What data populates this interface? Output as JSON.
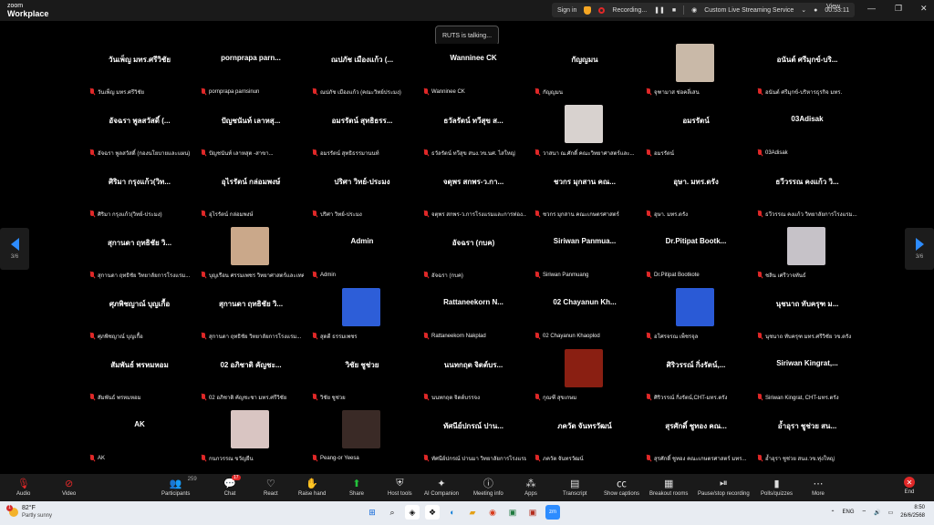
{
  "app": {
    "brand_line1": "zoom",
    "brand_line2": "Workplace"
  },
  "titlebar": {
    "sign_in": "Sign in",
    "recording": "Recording...",
    "streaming": "Custom Live Streaming Service",
    "timer": "00:53:11",
    "view": "View"
  },
  "talking": "RUTS is talking...",
  "pager": {
    "left": "3/6",
    "right": "3/6"
  },
  "tiles": [
    {
      "display": "วันเพ็ญ มทร.ศรีวิชัย",
      "label": "วันเพ็ญ มทร.ศรีวิชัย"
    },
    {
      "display": "pornprapa  parn...",
      "label": "pornprapa parnsinun"
    },
    {
      "display": "ณปภัช เมืองแก้ว (...",
      "label": "ณปภัช เมืองแก้ว (คณะวิทย์ประมง)"
    },
    {
      "display": "Wanninee CK",
      "label": "Wanninee CK"
    },
    {
      "display": "กัญญมน",
      "label": "กัญญมน"
    },
    {
      "display": "",
      "label": "จุฑามาส ช่อคลี่เสน",
      "photo": "#c9b9a8"
    },
    {
      "display": "อนันต์ ศรีมุกข์-บริ...",
      "label": "อนันต์ ศรีมุกข์-บริหารธุรกิจ มทร."
    },
    {
      "display": "อัจฉรา พูลสวัสดิ์ (...",
      "label": "อัจฉรา พูลสวัสดิ์ (กองนโยบายและแผน)"
    },
    {
      "display": "ปัญชนันท์ เลาหสุ...",
      "label": "ปัญชนันท์ เลาหสุต -สาขา..."
    },
    {
      "display": "อมรรัตน์ สุทธิธรร...",
      "label": "อมรรัตน์ สุทธิธรรมานนท์"
    },
    {
      "display": "ธวัลรัตน์ ทวีสุข ส...",
      "label": "ธวัลรัตน์ ทวีสุข สนง.วข.นศ. ไสใหญ่"
    },
    {
      "display": "",
      "label": "วาสนา ณ.ศักดิ์ คณะวิทยาศาสตร์และ...",
      "photo": "#d8d2cf"
    },
    {
      "display": "อมรรัตน์",
      "label": "อมรรัตน์"
    },
    {
      "display": "03Adisak",
      "label": "03Adisak"
    },
    {
      "display": "ศิริมา กรุงแก้ว(วิท...",
      "label": "ศิริมา กรุงแก้ว(วิทย์-ประมง)"
    },
    {
      "display": "อุไรรัตน์ กล่อมพงษ์",
      "label": "อุไรรัตน์ กล่อมพงษ์"
    },
    {
      "display": "ปริศา วิทย์-ประมง",
      "label": "ปริศา วิทย์-ประมง"
    },
    {
      "display": "จตุพร สกพร-ว.กา...",
      "label": "จตุพร สกพร-ว.การโรงแรมและการท่อง..."
    },
    {
      "display": "ชวกร มุกสาน คณ...",
      "label": "ชวกร มุกสาน คณะเกษตรศาสตร์"
    },
    {
      "display": "อุษา. มทร.ตรัง",
      "label": "อุษา. มทร.ตรัง"
    },
    {
      "display": "ธวีวรรณ คงแก้ว วิ...",
      "label": "ธวีวรรณ คงแก้ว วิทยาลัยการโรงแรม..."
    },
    {
      "display": "สุกานดา ฤทธิชัย วิ...",
      "label": "สุกานดา ฤทธิชัย วิทยาลัยการโรงแรม..."
    },
    {
      "display": "",
      "label": "บุญเรือน ศรรมเพชร วิทยาศาสตร์และเทค...",
      "photo": "#caa88a"
    },
    {
      "display": "Admin",
      "label": "Admin"
    },
    {
      "display": "อัจฉรา (กบค)",
      "label": "อัจฉรา (กบค)"
    },
    {
      "display": "Siriwan  Panmua...",
      "label": "Siriwan Panmuang"
    },
    {
      "display": "Dr.Pitipat  Bootk...",
      "label": "Dr.Pitipat Bootkote"
    },
    {
      "display": "",
      "label": "ชลิน เศรีวาจทันธ์",
      "photo": "#c6c2c8"
    },
    {
      "display": "ศุภพิชญาณ์ บุญเกื้อ",
      "label": "ศุภพิชญาณ์ บุญเกื้อ"
    },
    {
      "display": "สุกานดา ฤทธิชัย วิ...",
      "label": "สุกานดา ฤทธิชัย วิทยาลัยการโรงแรม..."
    },
    {
      "display": "",
      "label": "สุดดี ธรรมเพชร",
      "photo": "#2d5ed8"
    },
    {
      "display": "Rattaneekorn  N...",
      "label": "Rattaneekorn Nakplad"
    },
    {
      "display": "02 Chayanun Kh...",
      "label": "02 Chayanun Khaoplod"
    },
    {
      "display": "",
      "label": "อโศรจรณ เพ็ชรจุล",
      "photo": "#2a5ad6"
    },
    {
      "display": "นุชนาถ ทับครุฑ ม...",
      "label": "นุชนาถ ทับครุฑ มทร.ศรีวิชัย วข.ตรัง"
    },
    {
      "display": "สัมพันธ์ พรหมหอม",
      "label": "สัมพันธ์ พรหมหอม"
    },
    {
      "display": "02 อภิชาติ คัญชะ...",
      "label": "02 อภิชาติ คัญชะชา มทร.ศรีวิชัย"
    },
    {
      "display": "วิชัย ชูช่วย",
      "label": "วิชัย ชูช่วย"
    },
    {
      "display": "นนทกฤต จิตต์บร...",
      "label": "นนทกฤต จิตต์บรรจง"
    },
    {
      "display": "",
      "label": "กุณฑี สุขเกษม",
      "photo": "#8a1f12"
    },
    {
      "display": "ศิริวรรณ์ กิ่งรัตน์,...",
      "label": "ศิริวรรณ์ กิ่งรัตน์,CHT-มทร.ตรัง"
    },
    {
      "display": "Siriwan  Kingrat,...",
      "label": "Siriwan Kingrat, CHT-มทร.ตรัง"
    },
    {
      "display": "AK",
      "label": "AK"
    },
    {
      "display": "",
      "label": "กนกวรรณ ขวัญยืน",
      "photo": "#d9c5c2"
    },
    {
      "display": "",
      "label": "Peang-or Yeesa",
      "photo": "#3a2a26"
    },
    {
      "display": "ทัศนีย์ปกรณ์ ปาน...",
      "label": "ทัศนีย์ปกรณ์ ปานมา วิทยาลัยการโรงแรม..."
    },
    {
      "display": "ภควัต จันทรวัฒน์",
      "label": "ภควัต จันทรวัฒน์"
    },
    {
      "display": "สุรศักดิ์ ชูทอง คณ...",
      "label": "สุรศักดิ์ ชูทอง คณะเกษตรศาสตร์ มทร..."
    },
    {
      "display": "อ้ำอุรา ชูช่วย สน...",
      "label": "อ้ำอุรา ชูช่วย สนง.วข.ทุ่งใหญ่"
    }
  ],
  "toolbar": {
    "audio": "Audio",
    "video": "Video",
    "participants": "Participants",
    "participants_count": "259",
    "chat": "Chat",
    "chat_badge": "17",
    "react": "React",
    "raise_hand": "Raise hand",
    "share": "Share",
    "host_tools": "Host tools",
    "ai_companion": "AI Companion",
    "meeting_info": "Meeting info",
    "apps": "Apps",
    "transcript": "Transcript",
    "show_captions": "Show captions",
    "breakout_rooms": "Breakout rooms",
    "pause_recording": "Pause/stop recording",
    "polls": "Polls/quizzes",
    "more": "More",
    "end": "End"
  },
  "taskbar": {
    "temp": "82°F",
    "weather": "Partly sunny",
    "weather_badge": "1",
    "lang": "ENG",
    "time": "8:50",
    "date": "26/6/2568"
  },
  "colors": {
    "accent": "#2d8cff",
    "muted_red": "#e02828",
    "share_green": "#23c23b"
  }
}
